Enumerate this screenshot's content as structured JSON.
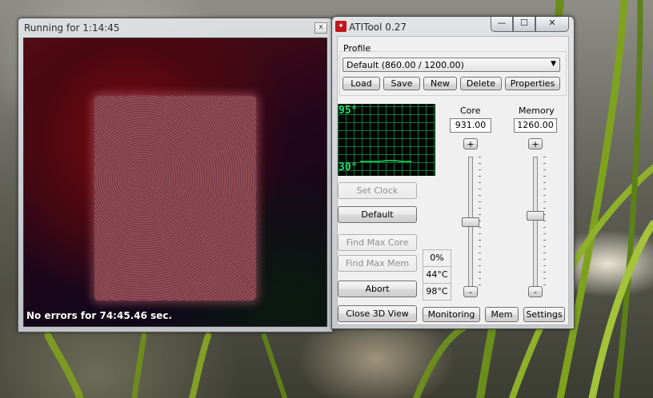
{
  "stress_window": {
    "title": "Running for 1:14:45",
    "close_glyph": "x",
    "status": "No errors for 74:45.46 sec."
  },
  "atitool": {
    "title": "ATITool 0.27",
    "caption_buttons": {
      "minimize": "—",
      "maximize": "☐",
      "close": "✕"
    },
    "profile": {
      "group_label": "Profile",
      "selected": "Default (860.00 / 1200.00)",
      "buttons": {
        "load": "Load",
        "save": "Save",
        "new": "New",
        "delete": "Delete",
        "properties": "Properties"
      }
    },
    "temp_graph": {
      "max_label": "95°",
      "min_label": "30°",
      "line_color": "#20e06a"
    },
    "core": {
      "label": "Core",
      "value": "931.00",
      "plus": "+",
      "minus": "-",
      "level": 0.5
    },
    "memory": {
      "label": "Memory",
      "value": "1260.00",
      "plus": "+",
      "minus": "-",
      "level": 0.55
    },
    "actions": {
      "set_clock": "Set Clock",
      "default": "Default",
      "find_max_core": "Find Max Core",
      "find_max_mem": "Find Max Mem",
      "abort": "Abort"
    },
    "stats": {
      "load": "0%",
      "temp_current": "44°C",
      "temp_max": "98°C"
    },
    "footer": {
      "close_3d": "Close 3D View",
      "monitoring": "Monitoring",
      "mem": "Mem",
      "settings": "Settings"
    }
  }
}
